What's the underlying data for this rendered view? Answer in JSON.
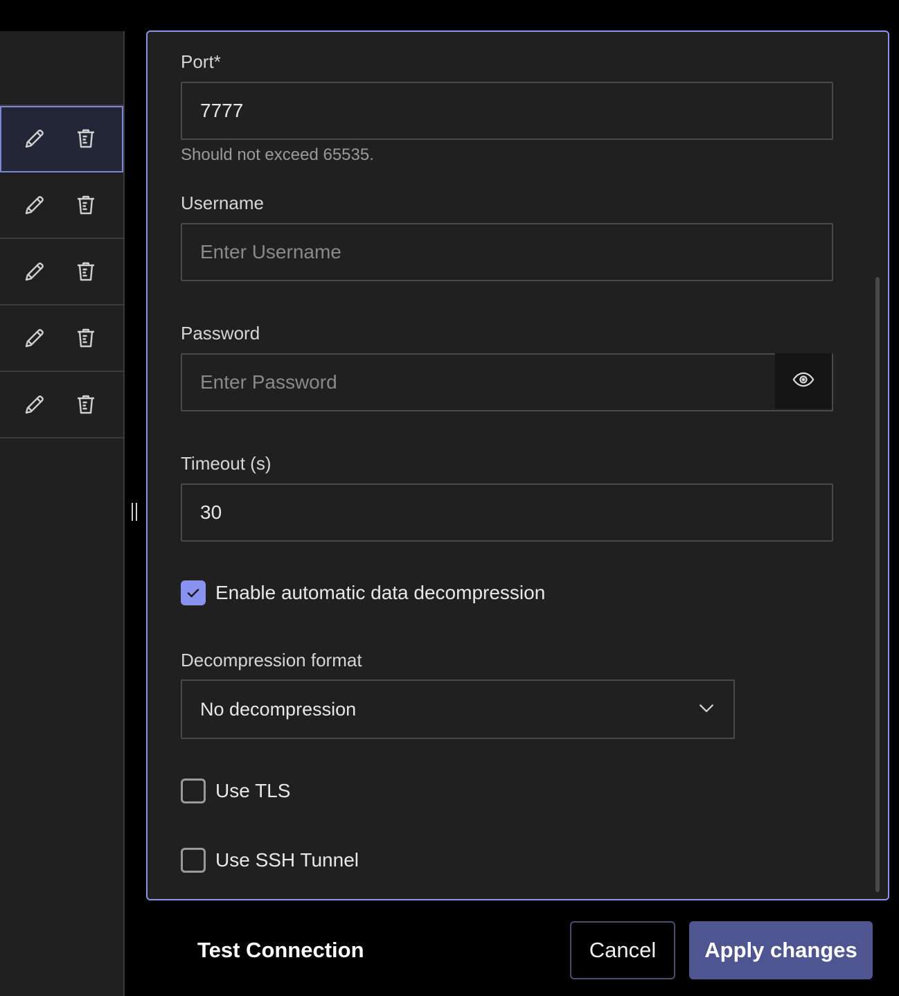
{
  "connections_list": {
    "rows": [
      {
        "selected": true
      },
      {
        "selected": false
      },
      {
        "selected": false
      },
      {
        "selected": false
      },
      {
        "selected": false
      }
    ],
    "row_icons": {
      "edit": "pencil-icon",
      "delete": "trash-icon"
    }
  },
  "form": {
    "port": {
      "label": "Port*",
      "value": "7777",
      "hint": "Should not exceed 65535."
    },
    "username": {
      "label": "Username",
      "value": "",
      "placeholder": "Enter Username"
    },
    "password": {
      "label": "Password",
      "value": "",
      "placeholder": "Enter Password",
      "toggle_icon": "eye-icon"
    },
    "timeout": {
      "label": "Timeout (s)",
      "value": "30"
    },
    "auto_decompress": {
      "label": "Enable automatic data decompression",
      "checked": true
    },
    "decompression_format": {
      "label": "Decompression format",
      "selected": "No decompression"
    },
    "use_tls": {
      "label": "Use TLS",
      "checked": false
    },
    "use_ssh": {
      "label": "Use SSH Tunnel",
      "checked": false
    }
  },
  "footer": {
    "test_label": "Test Connection",
    "cancel_label": "Cancel",
    "apply_label": "Apply changes"
  },
  "colors": {
    "accent": "#8a92f0",
    "primary_button": "#4e5591",
    "panel_border": "#8d95e6",
    "panel_bg": "#202020"
  }
}
